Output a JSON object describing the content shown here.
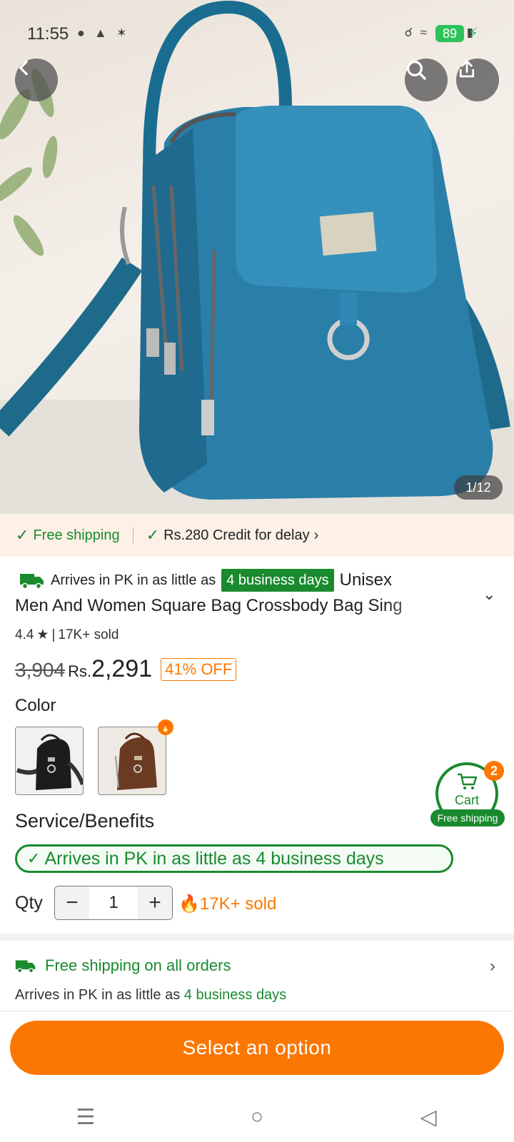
{
  "status_bar": {
    "time": "11:55",
    "battery": "89"
  },
  "hero": {
    "image_counter": "1/12"
  },
  "shipping_banner": {
    "free_shipping": "Free shipping",
    "credit": "Rs.280 Credit for delay"
  },
  "product": {
    "arrival_prefix": "Arrives in PK in as little as",
    "arrival_badge": "4 business days",
    "title_start": "Unisex",
    "title_line2": "Men And Women Square Bag Crossbody Bag Sing",
    "rating": "4.4",
    "sold": "17K+ sold",
    "original_price": "3,904",
    "currency": "Rs.",
    "price": "2,291",
    "discount": "41% OFF"
  },
  "color": {
    "label": "Color",
    "options": [
      "black",
      "brown"
    ]
  },
  "cart_float": {
    "label": "Cart",
    "count": "2",
    "free": "Free shipping"
  },
  "service": {
    "label": "Service/Benefits",
    "pill": "Arrives in PK in as little as 4 business days"
  },
  "qty": {
    "label": "Qty",
    "value": "1",
    "sold": "17K+ sold"
  },
  "shipping_info": {
    "title": "Free shipping on all orders",
    "arrive_prefix": "Arrives in PK in as little as",
    "arrive_days": "4 business days"
  },
  "cta": {
    "label": "Select an option"
  },
  "colors": {
    "accent": "#fb7701",
    "green": "#1a8a2e"
  }
}
